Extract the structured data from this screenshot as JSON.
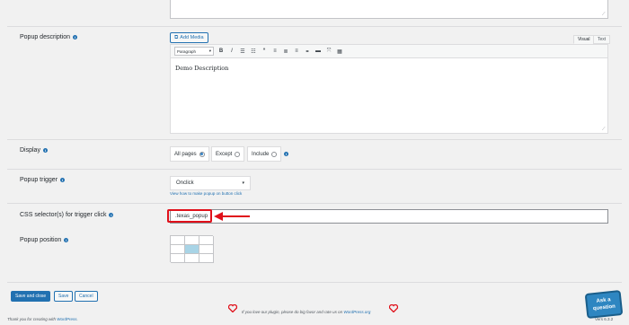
{
  "popup_description": {
    "label": "Popup description",
    "add_media": "Add Media",
    "tab_visual": "Visual",
    "tab_text": "Text",
    "format": "Paragraph",
    "toolbar_icons": [
      "bold-icon",
      "italic-icon",
      "bullet-list-icon",
      "numbered-list-icon",
      "blockquote-icon",
      "align-left-icon",
      "align-center-icon",
      "align-right-icon",
      "link-icon",
      "more-icon",
      "fullscreen-icon",
      "kitchen-sink-icon"
    ],
    "content": "Demo Description"
  },
  "display": {
    "label": "Display",
    "options": [
      {
        "label": "All pages",
        "checked": true
      },
      {
        "label": "Except",
        "checked": false
      },
      {
        "label": "Include",
        "checked": false
      }
    ]
  },
  "popup_trigger": {
    "label": "Popup trigger",
    "value": "Onclick",
    "help_link": "View how to make popup on button click"
  },
  "css_selector": {
    "label": "CSS selector(s) for trigger click",
    "value": ".texas_popup",
    "highlight_color": "#e0101a"
  },
  "popup_position": {
    "label": "Popup position",
    "selected_cell": 4
  },
  "actions": {
    "save_close": "Save and close",
    "save": "Save",
    "cancel": "Cancel"
  },
  "footer": {
    "thanks_prefix": "Thank you for creating with ",
    "thanks_link": "WordPress",
    "thanks_suffix": ".",
    "rate_text_prefix": "If you love our plugin, please do big favor and rate us on ",
    "rate_link": "WordPress.org",
    "version": "Vers  6.3.2"
  },
  "badge": {
    "line1": "Ask a",
    "line2": "question"
  },
  "colors": {
    "accent": "#2271b1",
    "heart": "#e0101a",
    "selected_cell": "#a8d4e6"
  }
}
